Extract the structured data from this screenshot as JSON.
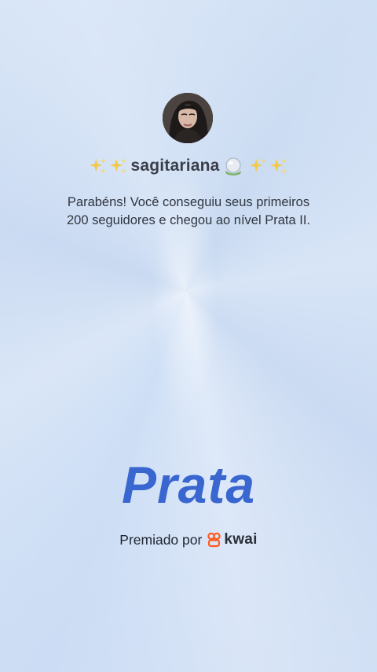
{
  "profile": {
    "username": "sagitariana",
    "avatar_icon": "profile-photo-avatar"
  },
  "decorations": {
    "left_icons": [
      "sparkles-icon",
      "sparkles-icon"
    ],
    "right_icons": [
      "crystal-ball-icon",
      "sparkles-icon",
      "sparkles-icon"
    ]
  },
  "message": {
    "line1": "Parabéns! Você conseguiu seus primeiros",
    "line2": "200 seguidores e chegou ao nível Prata II."
  },
  "level": {
    "name": "Prata"
  },
  "award": {
    "label": "Premiado por",
    "brand": "kwai",
    "brand_color": "#ff5a1f"
  },
  "colors": {
    "level_text": "#3a66cf",
    "background": "#c9d9f1"
  }
}
